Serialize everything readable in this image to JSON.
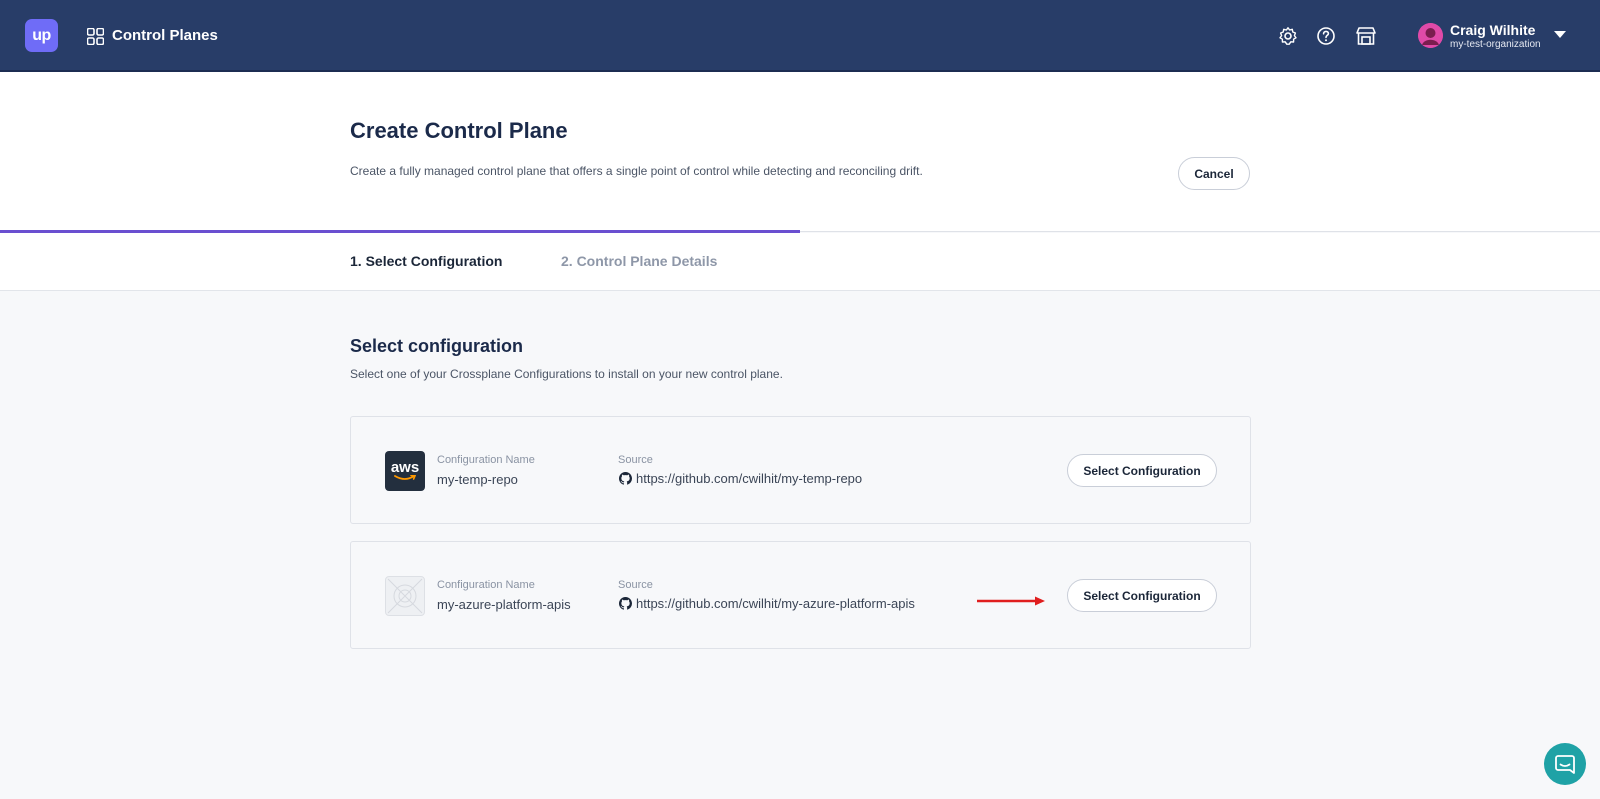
{
  "topbar": {
    "logo_text": "up",
    "section_title": "Control Planes",
    "icons": [
      "gear-icon",
      "help-icon",
      "marketplace-icon"
    ],
    "user": {
      "name": "Craig Wilhite",
      "org": "my-test-organization"
    }
  },
  "header": {
    "title": "Create Control Plane",
    "description": "Create a fully managed control plane that offers a single point of control while detecting and reconciling drift.",
    "cancel_label": "Cancel"
  },
  "progress": {
    "fraction": 0.5
  },
  "steps": [
    {
      "label": "1.  Select Configuration",
      "active": true
    },
    {
      "label": "2.  Control Plane Details",
      "active": false
    }
  ],
  "section": {
    "title": "Select configuration",
    "description": "Select one of your Crossplane Configurations to install on your new control plane."
  },
  "configurations": [
    {
      "icon": "aws-icon",
      "icon_text": "aws",
      "name_label": "Configuration Name",
      "name": "my-temp-repo",
      "source_label": "Source",
      "source": "https://github.com/cwilhit/my-temp-repo",
      "button_label": "Select Configuration"
    },
    {
      "icon": "placeholder-icon",
      "name_label": "Configuration Name",
      "name": "my-azure-platform-apis",
      "source_label": "Source",
      "source": "https://github.com/cwilhit/my-azure-platform-apis",
      "button_label": "Select Configuration"
    }
  ],
  "colors": {
    "nav_bg": "#283d68",
    "accent": "#6a4fd0",
    "logo_bg": "#6f6cf7",
    "annotation_arrow": "#e01e1e",
    "chat_bg": "#1fa2a6"
  }
}
